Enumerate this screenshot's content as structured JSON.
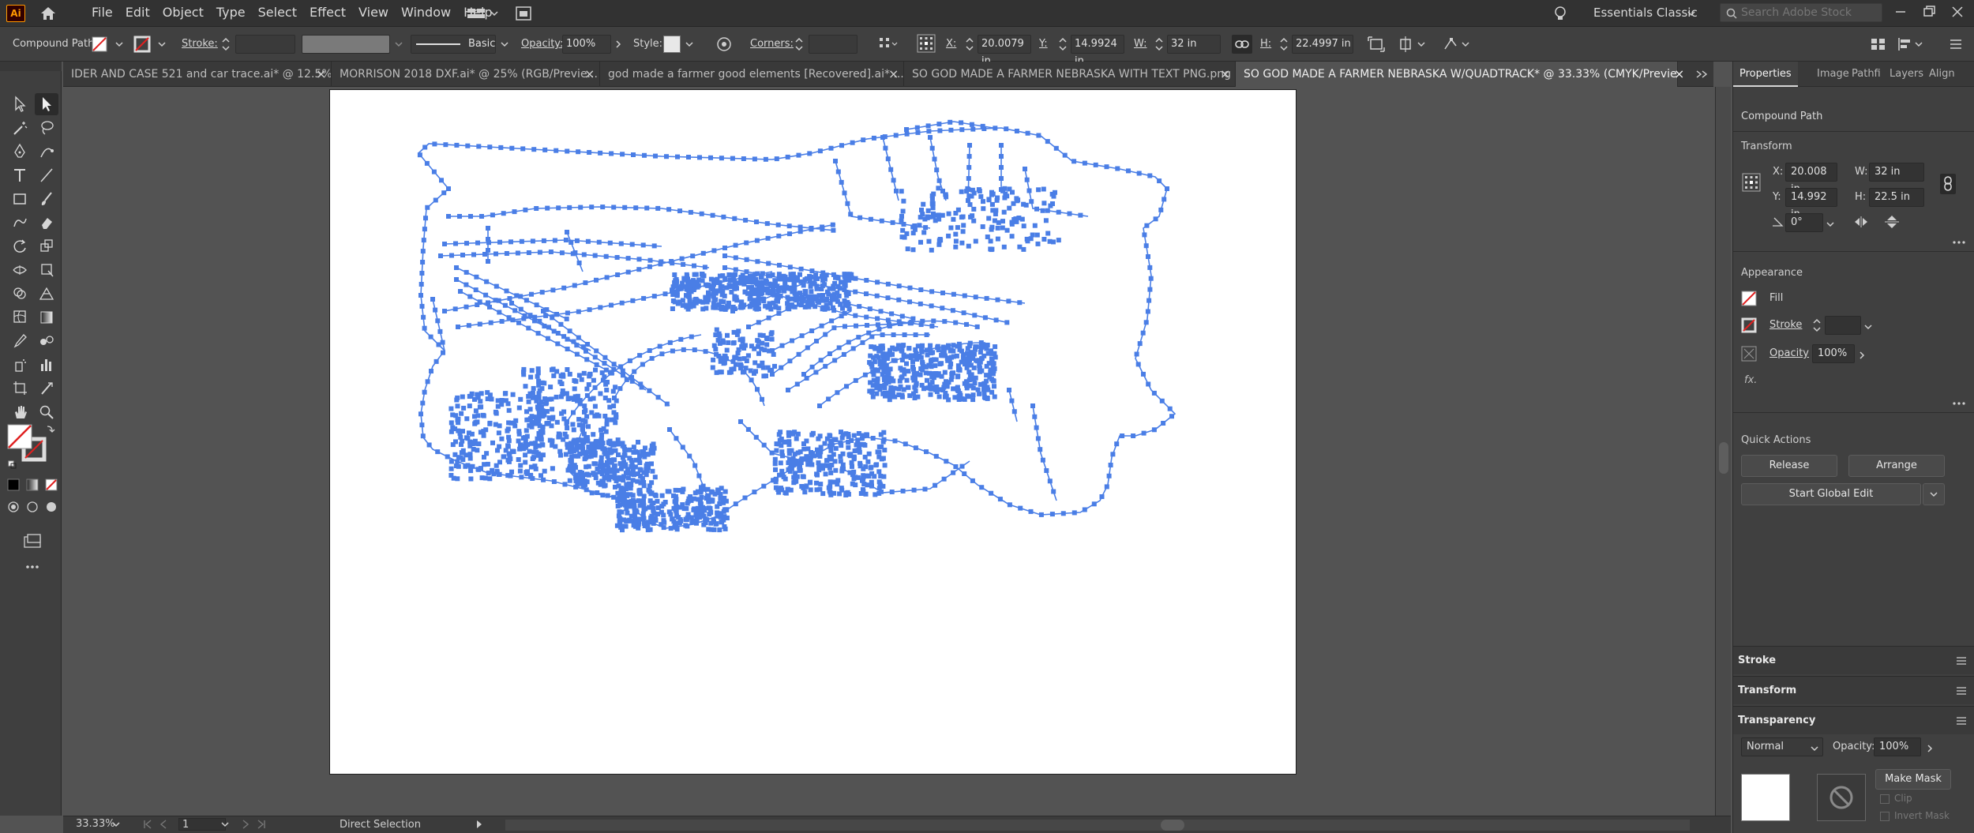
{
  "app": {
    "logo": "Ai"
  },
  "menu": [
    "File",
    "Edit",
    "Object",
    "Type",
    "Select",
    "Effect",
    "View",
    "Window",
    "Help"
  ],
  "workspace": "Essentials Classic",
  "search": {
    "placeholder": "Search Adobe Stock"
  },
  "control": {
    "object_type": "Compound Path",
    "stroke_label": "Stroke:",
    "brush": "Basic",
    "opacity_label": "Opacity:",
    "opacity_value": "100%",
    "style_label": "Style:",
    "corners_label": "Corners:",
    "x_label": "X:",
    "x_value": "20.0079 in",
    "y_label": "Y:",
    "y_value": "14.9924 in",
    "w_label": "W:",
    "w_value": "32 in",
    "h_label": "H:",
    "h_value": "22.4997 in"
  },
  "tabs": [
    {
      "label": "IDER AND CASE 521 and car trace.ai* @ 12.5% ...",
      "active": false
    },
    {
      "label": "MORRISON 2018 DXF.ai* @ 25% (RGB/Previe...",
      "active": false
    },
    {
      "label": "god made a farmer good elements [Recovered].ai* ...",
      "active": false
    },
    {
      "label": "SO GOD MADE A FARMER NEBRASKA WITH TEXT PNG.png",
      "active": false
    },
    {
      "label": "SO GOD MADE A FARMER NEBRASKA W/QUADTRACK* @ 33.33% (CMYK/Preview)",
      "active": true
    }
  ],
  "tab_close": "×",
  "panel": {
    "tabs": [
      "Properties",
      "Image",
      "Pathfi",
      "Layers",
      "Align"
    ],
    "selection_type": "Compound Path",
    "transform": {
      "title": "Transform",
      "x_label": "X:",
      "x": "20.008 in",
      "y_label": "Y:",
      "y": "14.992 in",
      "w_label": "W:",
      "w": "32 in",
      "h_label": "H:",
      "h": "22.5 in",
      "angle": "0°"
    },
    "appearance": {
      "title": "Appearance",
      "fill": "Fill",
      "stroke": "Stroke",
      "opacity_label": "Opacity",
      "opacity": "100%",
      "fx": "fx."
    },
    "quick_actions": {
      "title": "Quick Actions",
      "release": "Release",
      "arrange": "Arrange",
      "start_global_edit": "Start Global Edit"
    },
    "collapsed": [
      "Stroke",
      "Transform",
      "Transparency"
    ],
    "transparency": {
      "blend_mode": "Normal",
      "opacity_label": "Opacity:",
      "opacity": "100%",
      "make_mask": "Make Mask",
      "clip": "Clip",
      "invert_mask": "Invert Mask"
    }
  },
  "status": {
    "zoom": "33.33%",
    "artboard": "1",
    "tool": "Direct Selection"
  },
  "colors": {
    "path_color": "#4a7ee6",
    "stroke_swatch": "#e02020"
  }
}
